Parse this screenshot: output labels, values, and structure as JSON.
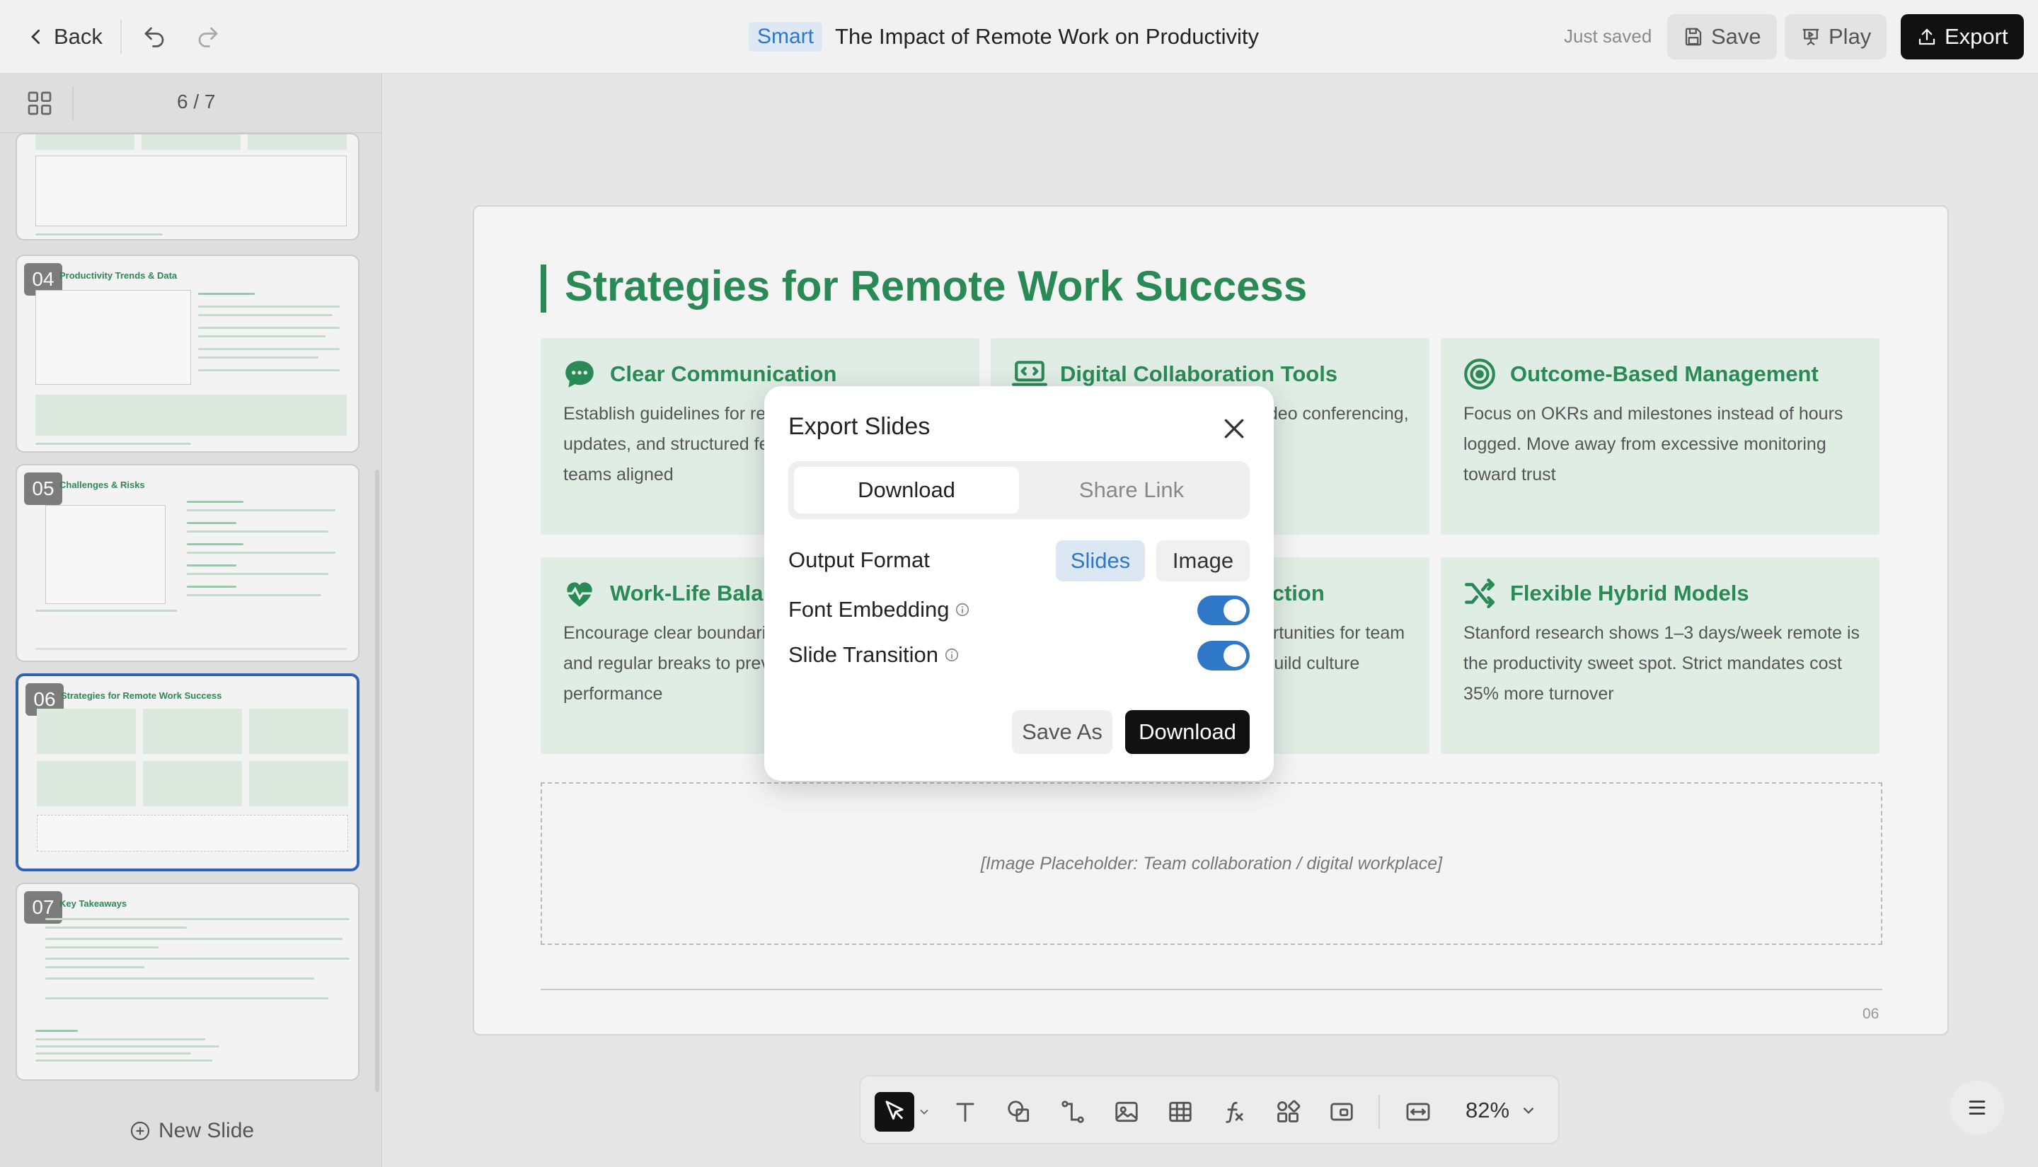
{
  "header": {
    "back_label": "Back",
    "smart_badge": "Smart",
    "doc_title": "The Impact of Remote Work on Productivity",
    "save_status": "Just saved",
    "save_label": "Save",
    "play_label": "Play",
    "export_label": "Export"
  },
  "sidebar": {
    "page_counter": "6 / 7",
    "new_slide_label": "New Slide",
    "thumbnails": [
      {
        "number": "",
        "title": ""
      },
      {
        "number": "04",
        "title": "Productivity Trends & Data"
      },
      {
        "number": "05",
        "title": "Challenges & Risks"
      },
      {
        "number": "06",
        "title": "Strategies for Remote Work Success"
      },
      {
        "number": "07",
        "title": "Key Takeaways"
      }
    ]
  },
  "slide": {
    "title": "Strategies for Remote Work Success",
    "cards": [
      {
        "icon": "chat-bubble-icon",
        "title": "Clear Communication",
        "body": "Establish guidelines for regular check-ins, async updates, and structured feedback loops to keep teams aligned"
      },
      {
        "icon": "laptop-code-icon",
        "title": "Digital Collaboration Tools",
        "body": "Invest in project management, video conferencing, and documentation platforms"
      },
      {
        "icon": "target-icon",
        "title": "Outcome-Based Management",
        "body": "Focus on OKRs and milestones instead of hours logged. Move away from excessive monitoring toward trust"
      },
      {
        "icon": "heartbeat-icon",
        "title": "Work-Life Balance",
        "body": "Encourage clear boundaries, flexible schedules, and regular breaks to prevent burnout and sustain performance"
      },
      {
        "icon": "users-icon",
        "title": "Foster Social Connection",
        "body": "Create structured in-person opportunities for team bonding to reduce isolation and build culture"
      },
      {
        "icon": "shuffle-icon",
        "title": "Flexible Hybrid Models",
        "body": "Stanford research shows 1–3 days/week remote is the productivity sweet spot. Strict mandates cost 35% more turnover"
      }
    ],
    "placeholder": "[Image Placeholder: Team collaboration / digital workplace]",
    "page_number": "06"
  },
  "toolbar": {
    "zoom": "82%"
  },
  "modal": {
    "title": "Export Slides",
    "tab_download": "Download",
    "tab_share": "Share Link",
    "output_format_label": "Output Format",
    "format_slides": "Slides",
    "format_image": "Image",
    "font_embedding_label": "Font Embedding",
    "font_embedding_on": true,
    "slide_transition_label": "Slide Transition",
    "slide_transition_on": true,
    "save_as_label": "Save As",
    "download_label": "Download"
  },
  "colors": {
    "accent_green": "#2a8a55",
    "accent_blue": "#2f77c7",
    "dark": "#111111"
  }
}
